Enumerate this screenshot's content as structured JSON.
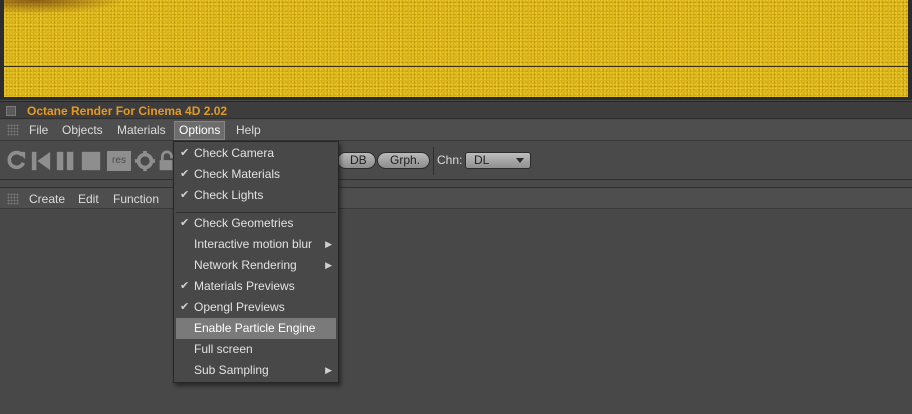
{
  "window": {
    "title": "Octane Render For Cinema 4D 2.02"
  },
  "menubar": {
    "items": [
      "File",
      "Objects",
      "Materials",
      "Options",
      "Help"
    ],
    "active": "Options"
  },
  "toolbar": {
    "res_label": "res",
    "db_label": "DB",
    "graph_label": "Grph.",
    "channel_label": "Chn:",
    "channel_value": "DL"
  },
  "material_menubar": {
    "items": [
      "Create",
      "Edit",
      "Function"
    ]
  },
  "options_menu": {
    "items": [
      {
        "label": "Check Camera",
        "checked": true,
        "submenu": false
      },
      {
        "label": "Check Materials",
        "checked": true,
        "submenu": false
      },
      {
        "label": "Check Lights",
        "checked": true,
        "submenu": false
      },
      {
        "label": "Check Geometries",
        "checked": true,
        "submenu": false
      },
      {
        "label": "Interactive motion blur",
        "checked": false,
        "submenu": true
      },
      {
        "label": "Network Rendering",
        "checked": false,
        "submenu": true
      },
      {
        "label": "Materials Previews",
        "checked": true,
        "submenu": false
      },
      {
        "label": "Opengl Previews",
        "checked": true,
        "submenu": false
      },
      {
        "label": "Enable Particle Engine",
        "checked": false,
        "submenu": false,
        "highlighted": true
      },
      {
        "label": "Full screen",
        "checked": false,
        "submenu": false
      },
      {
        "label": "Sub Sampling",
        "checked": false,
        "submenu": true
      }
    ]
  },
  "colors": {
    "title_orange": "#e49a22",
    "render_yellow": "#d9b015",
    "panel_gray": "#4a4a4a"
  }
}
